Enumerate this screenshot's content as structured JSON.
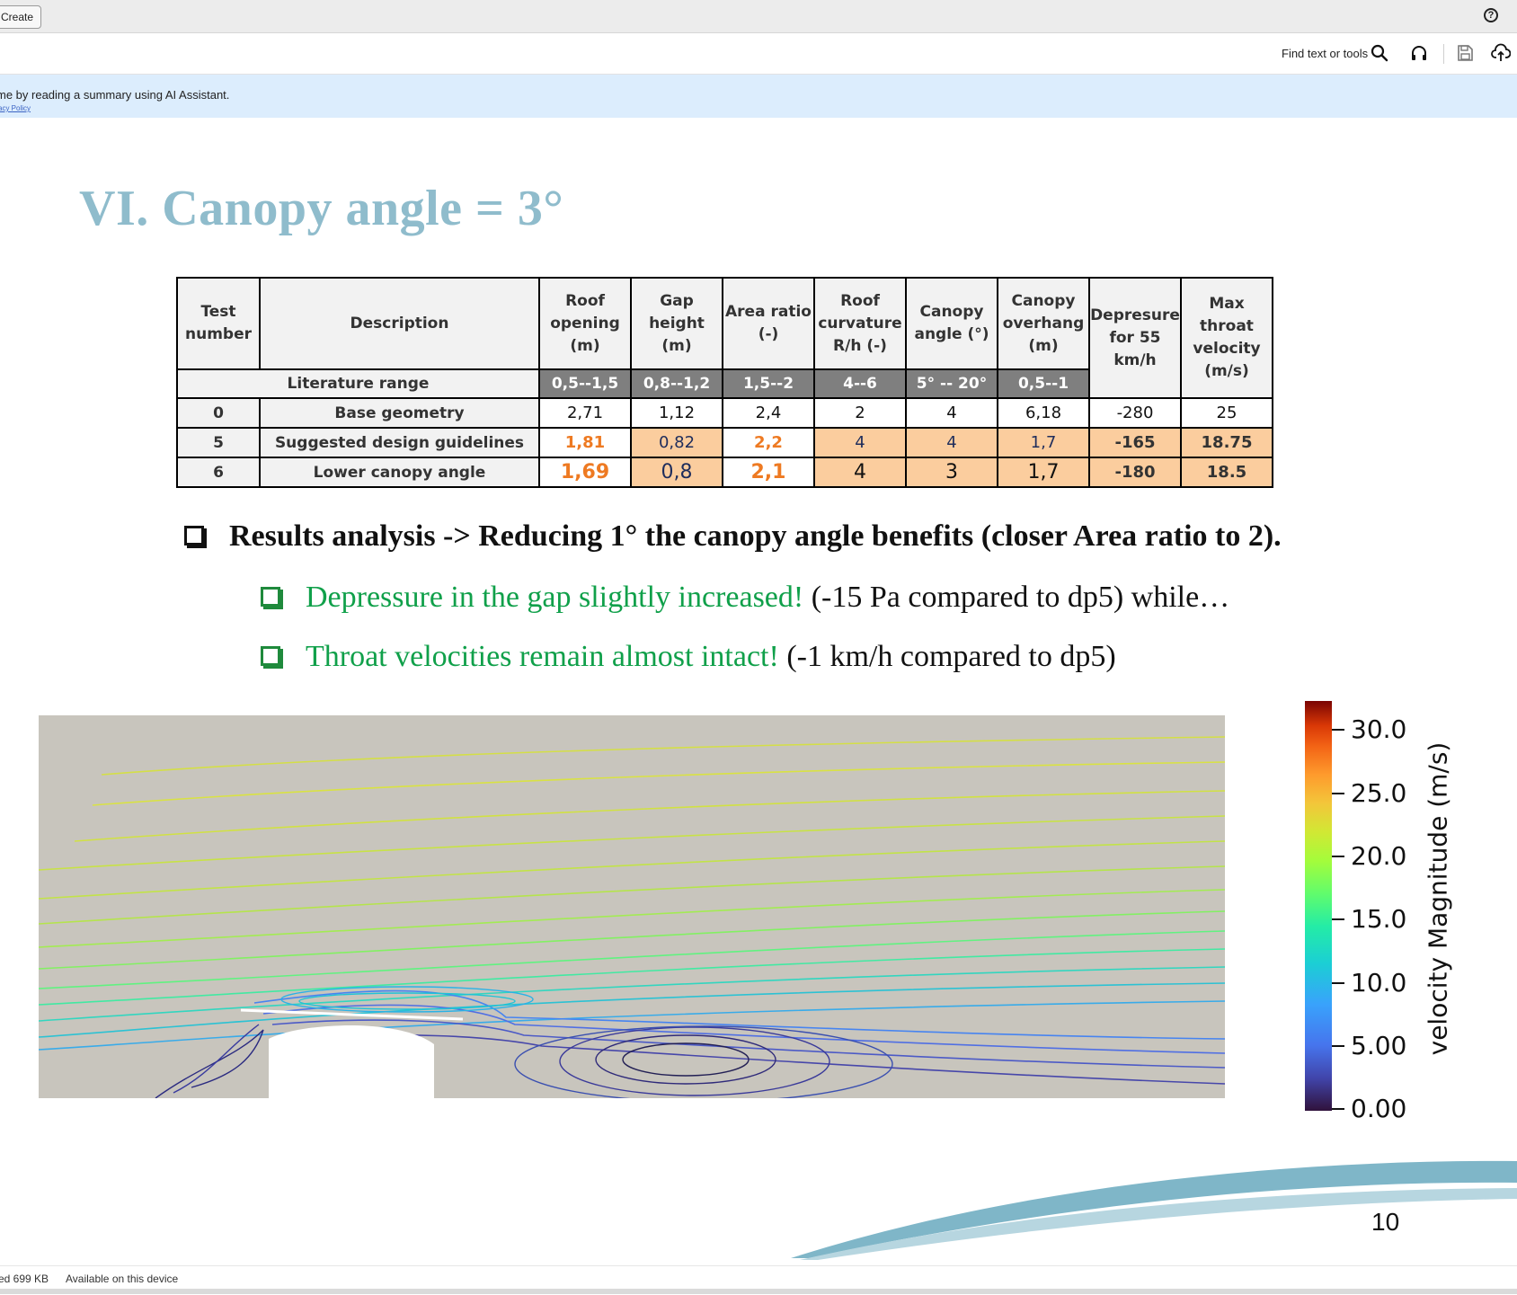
{
  "app": {
    "create_label": "Create",
    "find_text": "Find text or tools",
    "help_glyph": "?",
    "banner_text": "me by reading a summary using AI Assistant.",
    "banner_link": "vacy Policy",
    "icons": [
      "search-icon",
      "headphones-icon",
      "save-icon",
      "cloud-upload-icon",
      "help-icon"
    ]
  },
  "slide": {
    "title": "VI.  Canopy angle = 3°",
    "page_number": "10"
  },
  "table": {
    "headers": [
      "Test number",
      "Description",
      "Roof opening (m)",
      "Gap height (m)",
      "Area ratio (-)",
      "Roof curvature R/h (-)",
      "Canopy angle (°)",
      "Canopy overhang (m)",
      "Depresure for 55 km/h",
      "Max throat velocity (m/s)"
    ],
    "literature_label": "Literature range",
    "literature": [
      "0,5--1,5",
      "0,8--1,2",
      "1,5--2",
      "4--6",
      "5° -- 20°",
      "0,5--1"
    ],
    "rows": [
      {
        "num": "0",
        "desc": "Base geometry",
        "vals": [
          "2,71",
          "1,12",
          "2,4",
          "2",
          "4",
          "6,18",
          "-280",
          "25"
        ]
      },
      {
        "num": "5",
        "desc": "Suggested design guidelines",
        "vals": [
          "1,81",
          "0,82",
          "2,2",
          "4",
          "4",
          "1,7",
          "-165",
          "18.75"
        ]
      },
      {
        "num": "6",
        "desc": "Lower canopy angle",
        "vals": [
          "1,69",
          "0,8",
          "2,1",
          "4",
          "3",
          "1,7",
          "-180",
          "18.5"
        ]
      }
    ]
  },
  "bullets": {
    "b1": "Results analysis -> Reducing 1° the canopy angle benefits (closer Area ratio to 2).",
    "b2_green": "Depressure in the gap slightly increased!",
    "b2_rest": " (-15 Pa compared to dp5) while…",
    "b3_green": "Throat velocities remain almost intact!",
    "b3_rest": " (-1 km/h compared to dp5)"
  },
  "colorbar": {
    "title": "velocity Magnitude (m/s)",
    "ticks": [
      "30.0",
      "25.0",
      "20.0",
      "15.0",
      "10.0",
      "5.00",
      "0.00"
    ],
    "range": [
      0,
      30
    ]
  },
  "status": {
    "size": "ed  699 KB",
    "availability": "Available on this device"
  },
  "colors": {
    "title": "#8fbccc",
    "green_text": "#10a04a",
    "highlight": "#fbcd9e",
    "orange_value": "#ee7a22",
    "banner": "#dcedfd"
  }
}
